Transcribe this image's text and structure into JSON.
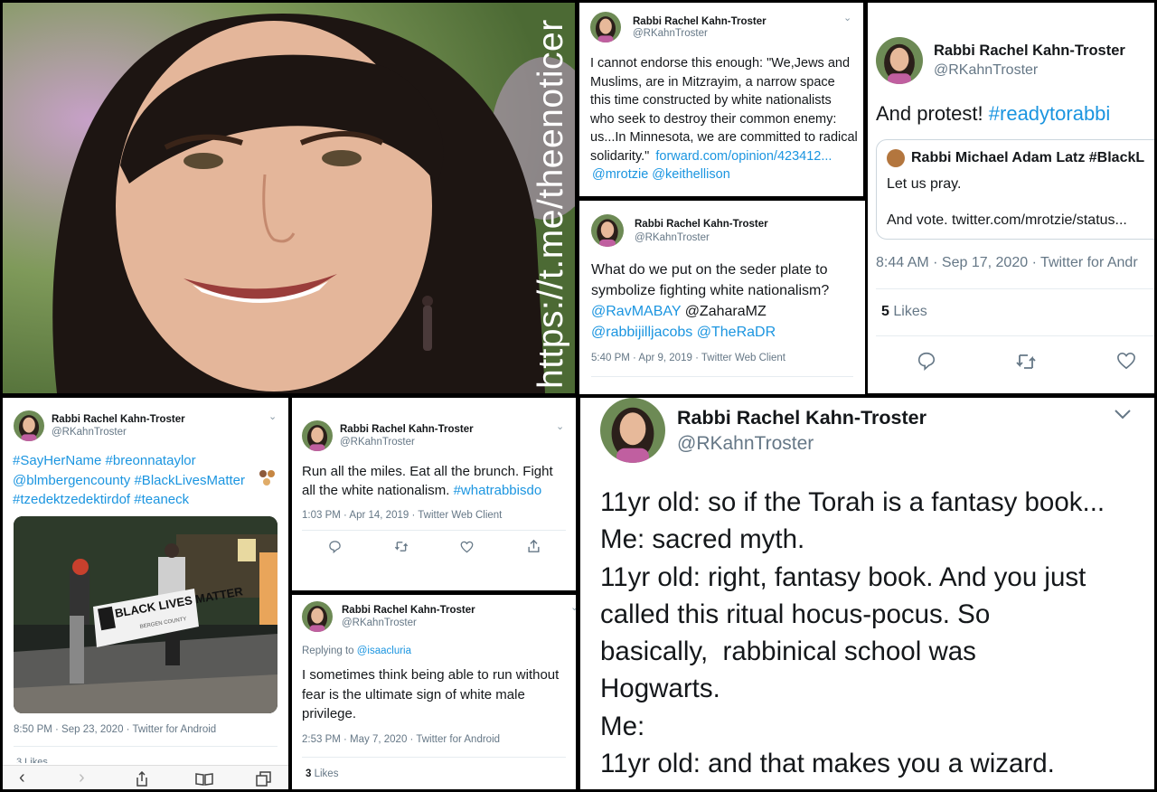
{
  "watermark": "https://t.me/theenoticer",
  "tweets": {
    "t1": {
      "name": "Rabbi Rachel Kahn-Troster",
      "handle": "@RKahnTroster",
      "text": "I cannot endorse this enough: \"We,Jews and Muslims, are in Mitzrayim, a narrow space this time constructed by white nationalists who seek to destroy their common enemy: us...In Minnesota, we are committed to radical solidarity.\"",
      "link1": "forward.com/opinion/423412...",
      "link2": "@mrotzie",
      "link3": "@keithellison"
    },
    "t2": {
      "name": "Rabbi Rachel Kahn-Troster",
      "handle": "@RKahnTroster",
      "text_part1": "What do we put on the seder plate to symbolize fighting white nationalism?",
      "mention1": "@RavMABAY",
      "mention2": "@ZaharaMZ",
      "mention3": "@rabbijilljacobs",
      "mention4": "@TheRaDR",
      "meta": "5:40 PM · Apr 9, 2019 · Twitter Web Client"
    },
    "t3": {
      "name": "Rabbi Rachel Kahn-Troster",
      "handle": "@RKahnTroster",
      "text": "And protest!",
      "hashtag": "#readytorabbi",
      "quoted_name": "Rabbi Michael Adam Latz #BlackL",
      "quoted_line1": "Let us pray.",
      "quoted_line2": "And vote. twitter.com/mrotzie/status...",
      "meta": "8:44 AM · Sep 17, 2020 · Twitter for Andr",
      "likes_count": "5",
      "likes_label": "Likes"
    },
    "t4": {
      "name": "Rabbi Rachel Kahn-Troster",
      "handle": "@RKahnTroster",
      "tags_line1": "#SayHerName #breonnataylor",
      "tags_line2": "@blmbergencounty #BlackLivesMatter",
      "tags_line3": "#tzedektzedektirdof #teaneck",
      "banner_text": "BLACK LIVES MATTER",
      "banner_sub": "BERGEN COUNTY",
      "meta": "8:50 PM · Sep 23, 2020 · Twitter for Android",
      "likes_partial": "3 Likes"
    },
    "t5": {
      "name": "Rabbi Rachel Kahn-Troster",
      "handle": "@RKahnTroster",
      "text": "Run all the miles. Eat all the brunch. Fight all the white nationalism.",
      "hashtag": "#whatrabbisdo",
      "meta": "1:03 PM · Apr 14, 2019 · Twitter Web Client"
    },
    "t6": {
      "name": "Rabbi Rachel Kahn-Troster",
      "handle": "@RKahnTroster",
      "replying_label": "Replying to",
      "replying_to": "@isaacluria",
      "text": "I sometimes think being able to run without fear is the ultimate sign of white male privilege.",
      "meta": "2:53 PM · May 7, 2020 · Twitter for Android",
      "likes_count": "3",
      "likes_label": "Likes"
    },
    "t7": {
      "name": "Rabbi Rachel Kahn-Troster",
      "handle": "@RKahnTroster",
      "lines": [
        "11yr old: so if the Torah is a fantasy book...",
        "Me: sacred myth.",
        "11yr old: right, fantasy book. And you just",
        "called this ritual hocus-pocus. So",
        "basically,  rabbinical school was",
        "Hogwarts.",
        "Me:",
        "11yr old: and that makes you a wizard."
      ]
    }
  },
  "colors": {
    "link": "#1b95e0",
    "text": "#14171a",
    "muted": "#657786",
    "divider": "#e6ecf0"
  },
  "icons": [
    "reply-icon",
    "retweet-icon",
    "like-icon",
    "share-icon",
    "chevron-down-icon",
    "back-icon",
    "forward-icon",
    "bookmarks-icon",
    "tabs-icon"
  ]
}
